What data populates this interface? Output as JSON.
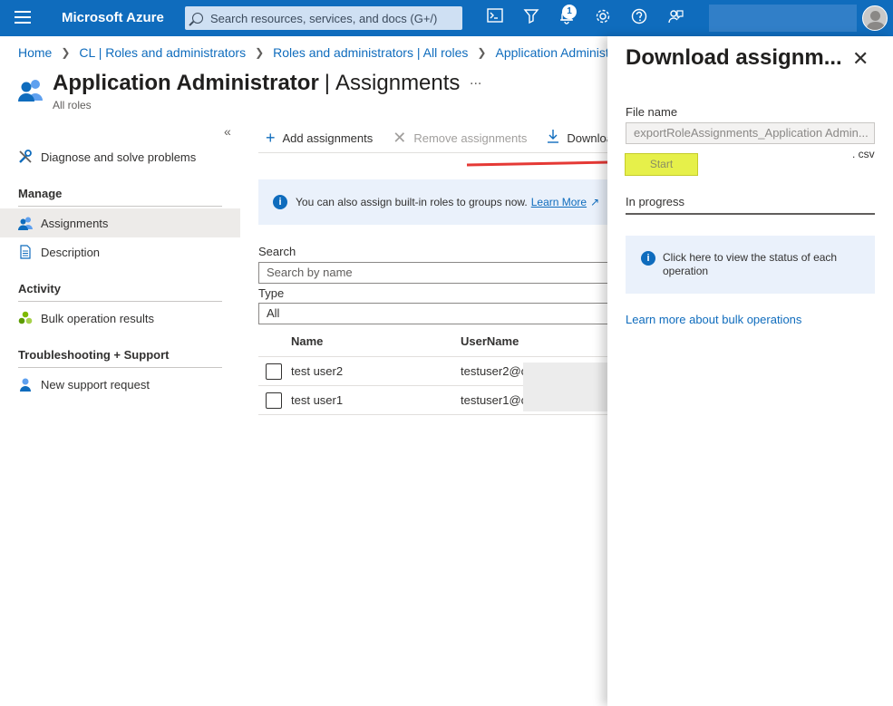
{
  "topbar": {
    "brand": "Microsoft Azure",
    "search_placeholder": "Search resources, services, and docs (G+/)",
    "notification_count": "1",
    "icons": [
      "menu-icon",
      "cloud-shell-icon",
      "directory-filter-icon",
      "bell-icon",
      "gear-icon",
      "help-icon",
      "feedback-icon"
    ]
  },
  "breadcrumb": [
    "Home",
    "CL | Roles and administrators",
    "Roles and administrators | All roles",
    "Application Administrator"
  ],
  "page": {
    "title": "Application Administrator",
    "section": "Assignments",
    "more": "...",
    "subtitle": "All roles"
  },
  "nav": {
    "collapse": "«",
    "items": {
      "diagnose": "Diagnose and solve problems",
      "assignments": "Assignments",
      "description": "Description",
      "bulk": "Bulk operation results",
      "support": "New support request"
    },
    "headings": {
      "manage": "Manage",
      "activity": "Activity",
      "troubleshooting": "Troubleshooting + Support"
    }
  },
  "toolbar": {
    "add": "Add assignments",
    "remove": "Remove assignments",
    "download": "Download assignments"
  },
  "info": {
    "text": "You can also assign built-in roles to groups now.",
    "link": "Learn More"
  },
  "filters": {
    "search_label": "Search",
    "search_placeholder": "Search by name",
    "type_label": "Type",
    "type_value": "All"
  },
  "table": {
    "headers": [
      "Name",
      "UserName"
    ],
    "rows": [
      {
        "name": "test user2",
        "username": "testuser2@c"
      },
      {
        "name": "test user1",
        "username": "testuser1@c"
      }
    ]
  },
  "panel": {
    "title": "Download assignm...",
    "close": "✕",
    "file_label": "File name",
    "file_value": "exportRoleAssignments_Application Admin...",
    "extension": ". csv",
    "start": "Start",
    "progress": "In progress",
    "status_info": "Click here to view the status of each operation",
    "learn_more": "Learn more about bulk operations"
  },
  "colors": {
    "azure_blue": "#0f6cbd",
    "start_highlight": "#e6f04a",
    "annotation_arrow": "#e53935"
  }
}
